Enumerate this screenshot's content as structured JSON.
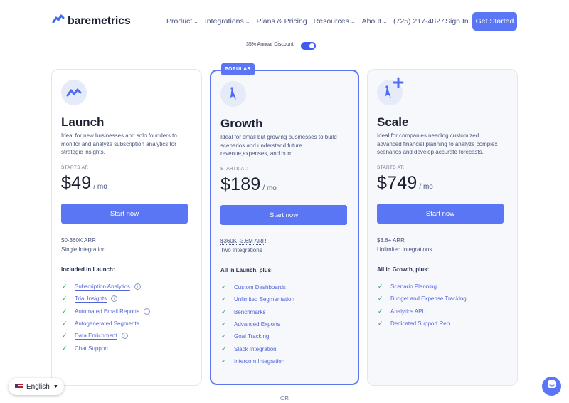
{
  "header": {
    "brand": "baremetrics",
    "nav": [
      {
        "label": "Product",
        "has_dropdown": true
      },
      {
        "label": "Integrations",
        "has_dropdown": true
      },
      {
        "label": "Plans & Pricing",
        "has_dropdown": false
      },
      {
        "label": "Resources",
        "has_dropdown": true
      },
      {
        "label": "About",
        "has_dropdown": true
      }
    ],
    "phone": "(725) 217-4827",
    "sign_in": "Sign In",
    "cta": "Get Started"
  },
  "discount": {
    "label": "35% Annual Discount",
    "enabled": true
  },
  "plans": [
    {
      "name": "Launch",
      "icon": "trend-icon",
      "description": "Ideal for new businesses and solo founders to monitor and analyze subscription analytics for strategic insights.",
      "starts_at": "STARTS AT:",
      "currency": "$",
      "price": "49",
      "period": "/ mo",
      "button": "Start now",
      "arr": "$0-360K ARR",
      "integrations": "Single Integration",
      "included_title": "Included in Launch:",
      "features": [
        {
          "label": "Subscription Analytics",
          "link": true,
          "info": true
        },
        {
          "label": "Trial Insights",
          "link": true,
          "info": true
        },
        {
          "label": "Automated Email Reports",
          "link": true,
          "info": true
        },
        {
          "label": "Autogenerated Segments",
          "link": false,
          "info": false
        },
        {
          "label": "Data Enrichment",
          "link": true,
          "info": true
        },
        {
          "label": "Chat Support",
          "link": false,
          "info": false
        }
      ]
    },
    {
      "name": "Growth",
      "icon": "compass-icon",
      "badge": "POPULAR",
      "description": "Ideal for small but growing businesses to build scenarios and understand future revenue,expenses, and burn.",
      "starts_at": "STARTS AT:",
      "currency": "$",
      "price": "189",
      "period": "/ mo",
      "button": "Start now",
      "arr": "$360K -3.6M ARR",
      "integrations": "Two Integrations",
      "included_title": "All in Launch, plus:",
      "features": [
        {
          "label": "Custom Dashboards"
        },
        {
          "label": "Unlimited Segmentation"
        },
        {
          "label": "Benchmarks"
        },
        {
          "label": "Advanced Exports"
        },
        {
          "label": "Goal Tracking"
        },
        {
          "label": "Slack Integration"
        },
        {
          "label": "Intercom Integration"
        }
      ]
    },
    {
      "name": "Scale",
      "icon": "compass-plus-icon",
      "description": "Ideal for companies needing customized advanced financial planning to analyze complex scenarios and develop accurate forecasts.",
      "starts_at": "STARTS AT:",
      "currency": "$",
      "price": "749",
      "period": "/ mo",
      "button": "Start now",
      "arr": "$3.6+ ARR",
      "integrations": "Unlimited Integrations",
      "included_title": "All in Growth, plus:",
      "features": [
        {
          "label": "Scenario Planning"
        },
        {
          "label": "Budget and Expense Tracking"
        },
        {
          "label": "Analytics API"
        },
        {
          "label": "Dedicated Support Rep"
        }
      ]
    }
  ],
  "or_text": "OR",
  "language": {
    "label": "English"
  },
  "colors": {
    "accent": "#5a76f5",
    "check": "#2ba16b",
    "text_dark": "#1c2134"
  }
}
